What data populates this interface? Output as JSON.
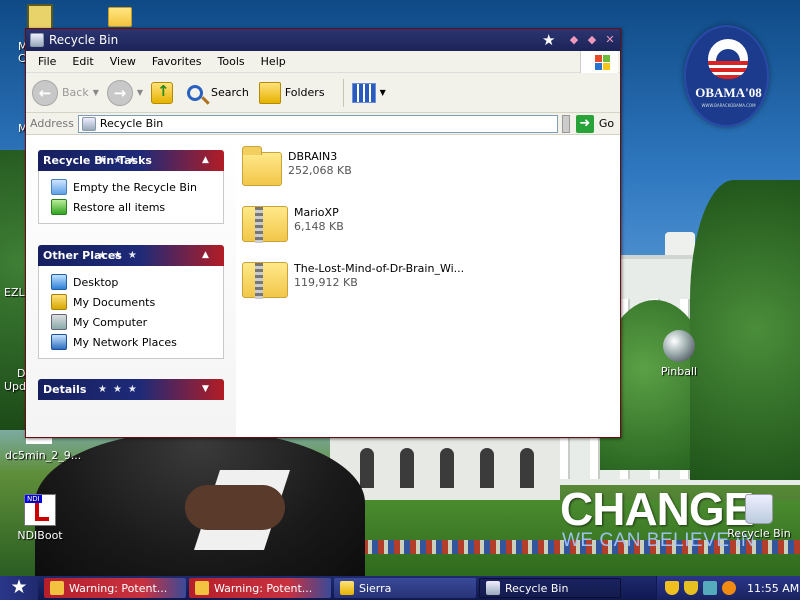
{
  "window": {
    "title": "Recycle Bin",
    "menu": [
      "File",
      "Edit",
      "View",
      "Favorites",
      "Tools",
      "Help"
    ],
    "toolbar": {
      "back_label": "Back",
      "search_label": "Search",
      "folders_label": "Folders"
    },
    "address": {
      "label": "Address",
      "value": "Recycle Bin",
      "go_label": "Go"
    },
    "panels": {
      "tasks": {
        "title": "Recycle Bin Tasks",
        "items": [
          "Empty the Recycle Bin",
          "Restore all items"
        ]
      },
      "other_places": {
        "title": "Other Places",
        "items": [
          "Desktop",
          "My Documents",
          "My Computer",
          "My Network Places"
        ]
      },
      "details": {
        "title": "Details"
      }
    },
    "files": [
      {
        "name": "DBRAIN3",
        "size": "252,068 KB",
        "type": "folder"
      },
      {
        "name": "MarioXP",
        "size": "6,148 KB",
        "type": "zip"
      },
      {
        "name": "The-Lost-Mind-of-Dr-Brain_Wi...",
        "size": "119,912 KB",
        "type": "zip"
      }
    ]
  },
  "desktop": {
    "icons": {
      "pinball": "Pinball",
      "recycle_bin": "Recycle Bin",
      "ndiboot": "NDIBoot",
      "ndi_tag": "NDI",
      "dc5min": "dc5min_2_9...",
      "ezlo": "EZLo",
      "updates_d": "D",
      "updates": "Upda",
      "left_m1": "M",
      "left_c": "C",
      "left_m2": "M"
    },
    "wallpaper": {
      "logo_name": "OBAMA'08",
      "logo_url": "WWW.BARACKOBAMA.COM",
      "headline": "CHANGE",
      "subline": "WE CAN BELIEVE IN"
    }
  },
  "taskbar": {
    "tasks": [
      {
        "label": "Warning: Potent...",
        "icon": "warning-icon"
      },
      {
        "label": "Warning: Potent...",
        "icon": "warning-icon"
      },
      {
        "label": "Sierra",
        "icon": "folder-icon"
      },
      {
        "label": "Recycle Bin",
        "icon": "recycle-bin-icon"
      }
    ],
    "clock": "11:55 AM"
  },
  "colors": {
    "titlebar": "#1c2358",
    "panel_head_blue": "#1e2a78",
    "panel_head_red": "#b21c25",
    "taskbar": "#1f2a6e"
  }
}
